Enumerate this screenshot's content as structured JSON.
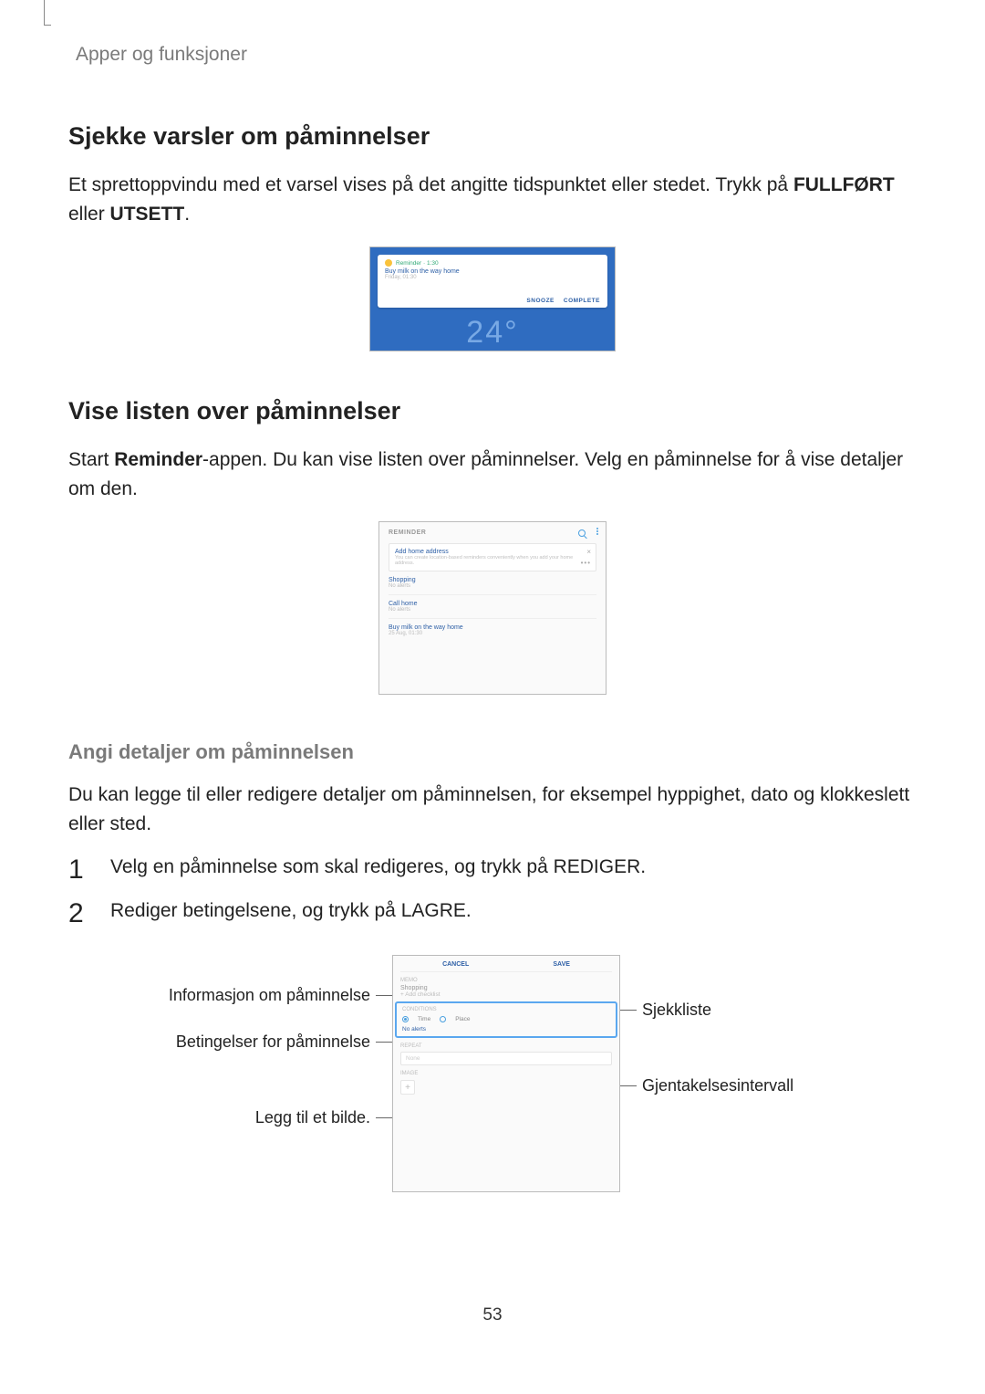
{
  "header": {
    "crumb": "Apper og funksjoner"
  },
  "section1": {
    "title": "Sjekke varsler om påminnelser",
    "para_a": "Et sprettoppvindu med et varsel vises på det angitte tidspunktet eller stedet. Trykk på ",
    "bold_a": "FULLFØRT",
    "para_b": " eller ",
    "bold_b": "UTSETT",
    "para_c": "."
  },
  "fig1": {
    "pill": "Reminder · 1:30",
    "title_line": "Buy milk on the way home",
    "sub_line": "Friday, 01:30",
    "btn_snooze": "SNOOZE",
    "btn_complete": "COMPLETE",
    "bg_num": "24°"
  },
  "section2": {
    "title": "Vise listen over påminnelser",
    "para_a": "Start ",
    "bold_a": "Reminder",
    "para_b": "-appen. Du kan vise listen over påminnelser. Velg en påminnelse for å vise detaljer om den."
  },
  "fig2": {
    "app_title": "REMINDER",
    "tip_line1": "Add home address",
    "tip_line2": "You can create location-based reminders conveniently when you add your home address.",
    "item1_t": "Shopping",
    "item1_s": "No alerts",
    "item2_t": "Call home",
    "item2_s": "No alerts",
    "item3_t": "Buy milk on the way home",
    "item3_s": "25 Aug, 01:30"
  },
  "section3": {
    "title": "Angi detaljer om påminnelsen",
    "para": "Du kan legge til eller redigere detaljer om påminnelsen, for eksempel hyppighet, dato og klokkeslett eller sted."
  },
  "steps": {
    "s1_a": "Velg en påminnelse som skal redigeres, og trykk på ",
    "s1_bold": "REDIGER",
    "s1_b": ".",
    "s2_a": "Rediger betingelsene, og trykk på ",
    "s2_bold": "LAGRE",
    "s2_b": "."
  },
  "fig3": {
    "top_cancel": "CANCEL",
    "top_save": "SAVE",
    "memo_lab": "MEMO",
    "memo_val": "Shopping",
    "memo_add": "+  Add checklist",
    "cond_lab": "CONDITIONS",
    "radio_time": "Time",
    "radio_place": "Place",
    "no_alerts": "No alerts",
    "repeat_lab": "REPEAT",
    "repeat_field": "None",
    "image_lab": "IMAGE"
  },
  "labels": {
    "left1": "Informasjon om påminnelse",
    "left2": "Betingelser for påminnelse",
    "left3": "Legg til et bilde.",
    "right1": "Sjekkliste",
    "right2": "Gjentakelsesintervall"
  },
  "page_number": "53"
}
